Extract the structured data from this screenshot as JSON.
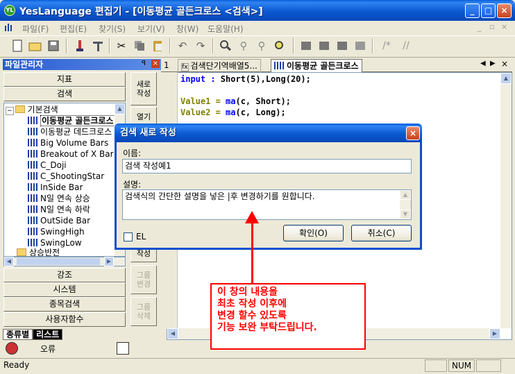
{
  "window": {
    "title": "YesLanguage 편집기 - [이동평균 골든크로스 <검색>]",
    "app_icon_text": "YL"
  },
  "menu": [
    "파일(F)",
    "편집(E)",
    "찾기(S)",
    "보기(V)",
    "창(W)",
    "도움말(H)"
  ],
  "left_panel": {
    "title": "파일관리자",
    "categories_top": [
      "지표",
      "검색"
    ],
    "tree": {
      "root_folder": "기본검색",
      "items": [
        "이동평균 골든크로스",
        "이동평균 데드크로스",
        "Big Volume Bars",
        "Breakout of X Bar",
        "C_Doji",
        "C_ShootingStar",
        "InSide Bar",
        "N일 연속 상승",
        "N일 연속 하락",
        "OutSide Bar",
        "SwingHigh",
        "SwingLow"
      ],
      "next_folder": "상승반전"
    },
    "categories_bottom": [
      "강조",
      "시스템",
      "종목검색",
      "사용자함수"
    ],
    "side_buttons": [
      "새로\n작성",
      "열기",
      "작성",
      "그룹\n변경",
      "그룹\n삭제"
    ],
    "bottom_tabs": [
      "종류별",
      "리스트"
    ],
    "error_label": "오류"
  },
  "tabs": [
    "1",
    "검색단기역배열5...",
    "이동평균 골든크로스"
  ],
  "editor": {
    "lines": [
      {
        "kw": "input :",
        "rest": " Short(5),Long(20);"
      },
      {
        "kw": "",
        "rest": ""
      },
      {
        "kw": "Value1 = ",
        "fn": "ma",
        "rest": "(c, Short);"
      },
      {
        "kw": "Value2 = ",
        "fn": "ma",
        "rest": "(c, Long);"
      }
    ]
  },
  "dialog": {
    "title": "검색 새로 작성",
    "name_label": "이름:",
    "name_value": "검색 작성예1",
    "desc_label": "설명:",
    "desc_value": "검색식의 간단한 설명을 넣은 |후 변경하기를 원합니다.",
    "checkbox_label": "EL",
    "ok_button": "확인(O)",
    "cancel_button": "취소(C)"
  },
  "annotation": {
    "text": "이 창의 내용을\n최초 작성 이후에\n변경 할수 있도록\n기능 보완 부탁드립니다."
  },
  "status": {
    "ready": "Ready",
    "num": "NUM"
  },
  "colors": {
    "title_blue": "#0a5fd8",
    "annotation_red": "#ff0000",
    "keyword_blue": "#0000ff",
    "code_olive": "#808000"
  }
}
